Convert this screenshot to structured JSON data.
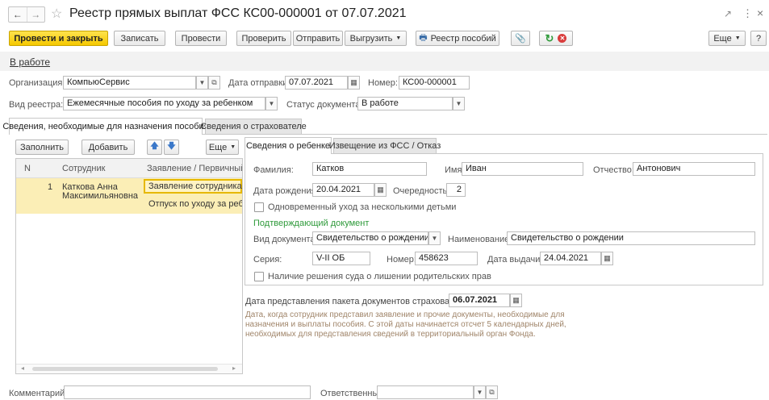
{
  "window": {
    "title": "Реестр прямых выплат ФСС КС00-000001 от 07.07.2021",
    "back_glyph": "←",
    "forward_glyph": "→",
    "star_glyph": "☆",
    "link_glyph": "🔗",
    "more_glyph": "⋮",
    "close_glyph": "×"
  },
  "toolbar": {
    "post_close": "Провести и закрыть",
    "save": "Записать",
    "post": "Провести",
    "check": "Проверить",
    "send": "Отправить",
    "export": "Выгрузить",
    "registry": "Реестр пособий",
    "more": "Еще",
    "help": "?"
  },
  "status_link": "В работе",
  "header": {
    "org_label": "Организация:",
    "org_value": "КомпьюСервис",
    "send_date_label": "Дата отправки:",
    "send_date_value": "07.07.2021",
    "number_label": "Номер:",
    "number_value": "КС00-000001",
    "registry_type_label": "Вид реестра:",
    "registry_type_value": "Ежемесячные пособия по уходу за ребенком",
    "doc_status_label": "Статус документа:",
    "doc_status_value": "В работе"
  },
  "main_tabs": [
    {
      "label": "Сведения, необходимые для назначения пособия"
    },
    {
      "label": "Сведения о страхователе"
    }
  ],
  "left_toolbar": {
    "fill": "Заполнить",
    "add": "Добавить",
    "more": "Еще"
  },
  "table": {
    "headers": [
      "N",
      "Сотрудник",
      "Заявление / Первичный д"
    ],
    "rows": [
      {
        "n": "1",
        "employee_line1": "Каткова Анна",
        "employee_line2": "Максимильяновна",
        "doc1": "Заявление сотрудника на",
        "doc2": "Отпуск по уходу за ребен"
      }
    ]
  },
  "child_tabs": [
    {
      "label": "Сведения о ребенке"
    },
    {
      "label": "Извещение из ФСС / Отказ"
    }
  ],
  "child": {
    "surname_label": "Фамилия:",
    "surname_value": "Катков",
    "name_label": "Имя:",
    "name_value": "Иван",
    "patronymic_label": "Отчество:",
    "patronymic_value": "Антонович",
    "birth_label": "Дата рождения:",
    "birth_value": "20.04.2021",
    "order_label": "Очередность:",
    "order_value": "2",
    "multi_care_label": "Одновременный уход за несколькими детьми",
    "confirm_doc_header": "Подтверждающий документ",
    "doc_type_label": "Вид документа:",
    "doc_type_value": "Свидетельство о рождении",
    "doc_name_label": "Наименование:",
    "doc_name_value": "Свидетельство о рождении",
    "series_label": "Серия:",
    "series_value": "V-II ОБ",
    "num_label": "Номер:",
    "num_value": "458623",
    "issue_label": "Дата выдачи:",
    "issue_value": "24.04.2021",
    "court_label": "Наличие решения суда о лишении родительских прав"
  },
  "package": {
    "label": "Дата представления пакета документов страхователю:",
    "value": "06.07.2021",
    "note_line1": "Дата, когда сотрудник представил заявление и прочие документы, необходимые для",
    "note_line2": "назначения и выплаты пособия. С этой даты начинается отсчет 5 календарных дней,",
    "note_line3": "необходимых для представления сведений в территориальный орган Фонда."
  },
  "footer": {
    "comment_label": "Комментарий:",
    "comment_value": "",
    "responsible_label": "Ответственный:",
    "responsible_value": ""
  },
  "colors": {
    "accent_yellow": "#f5c800",
    "highlight_row": "#fbeeb6",
    "green_header": "#2e9a3a",
    "note_text": "#a0856a"
  }
}
